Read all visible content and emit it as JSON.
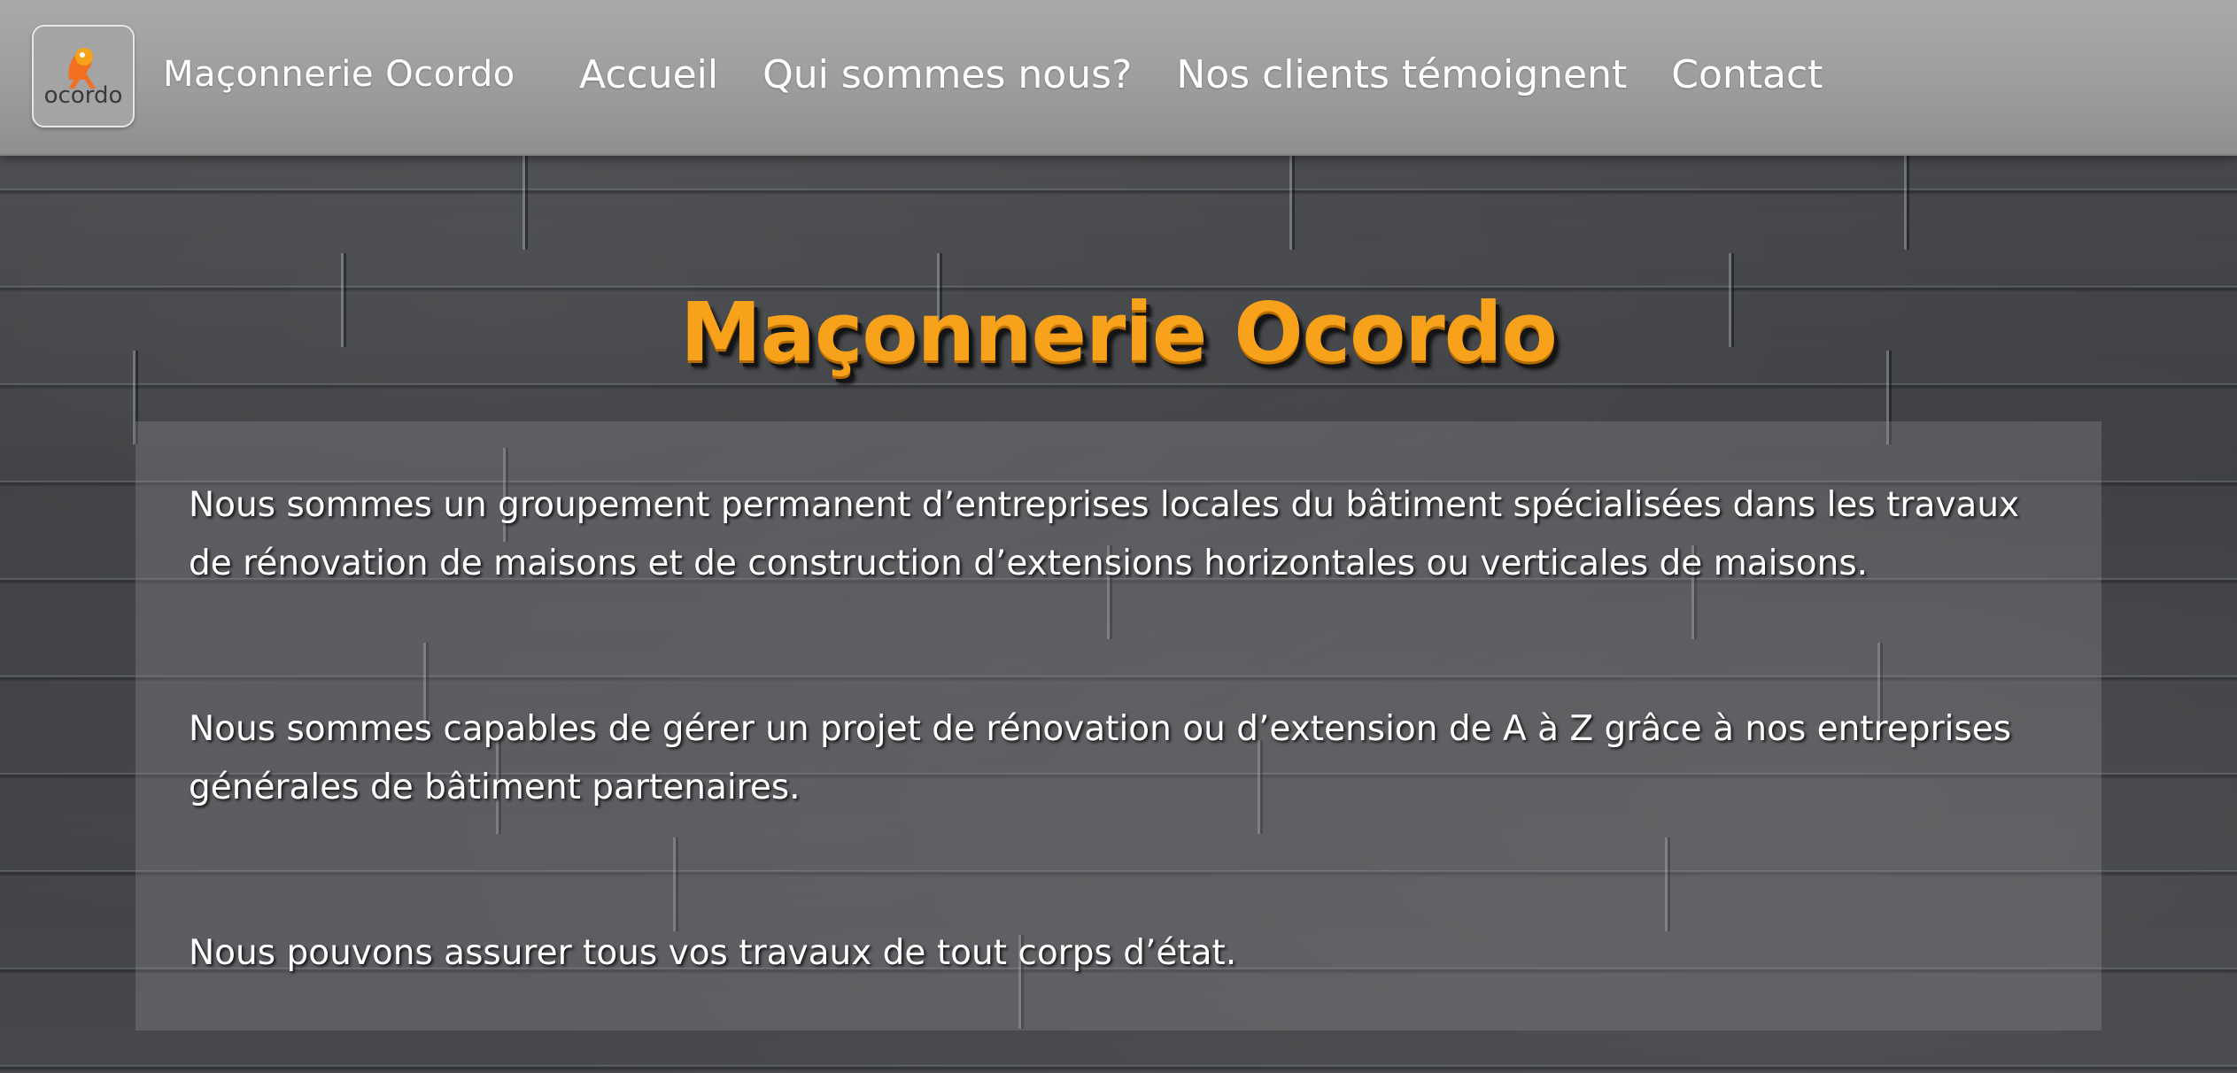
{
  "header": {
    "logo_text": "ocordo",
    "brand": "Maçonnerie Ocordo",
    "menu": [
      {
        "label": "Accueil"
      },
      {
        "label": "Qui sommes nous?"
      },
      {
        "label": "Nos clients témoignent"
      },
      {
        "label": "Contact"
      }
    ]
  },
  "hero": {
    "title": "Maçonnerie Ocordo"
  },
  "content": {
    "paragraphs": [
      "Nous sommes un groupement permanent d’entreprises locales du bâtiment spécialisées dans les travaux de rénovation de maisons et de construction d’extensions horizontales ou verticales de maisons.",
      "Nous sommes capables de gérer un projet de rénovation ou d’extension de A à Z grâce à nos entreprises générales de bâtiment partenaires.",
      "Nous pouvons assurer tous vos travaux de tout corps d’état."
    ]
  },
  "colors": {
    "accent": "#f8a11a",
    "nav_bg": "#9d9d9d",
    "wall": "#3f4143"
  },
  "icons": {
    "logo": "ocordo-mascot-logo"
  }
}
